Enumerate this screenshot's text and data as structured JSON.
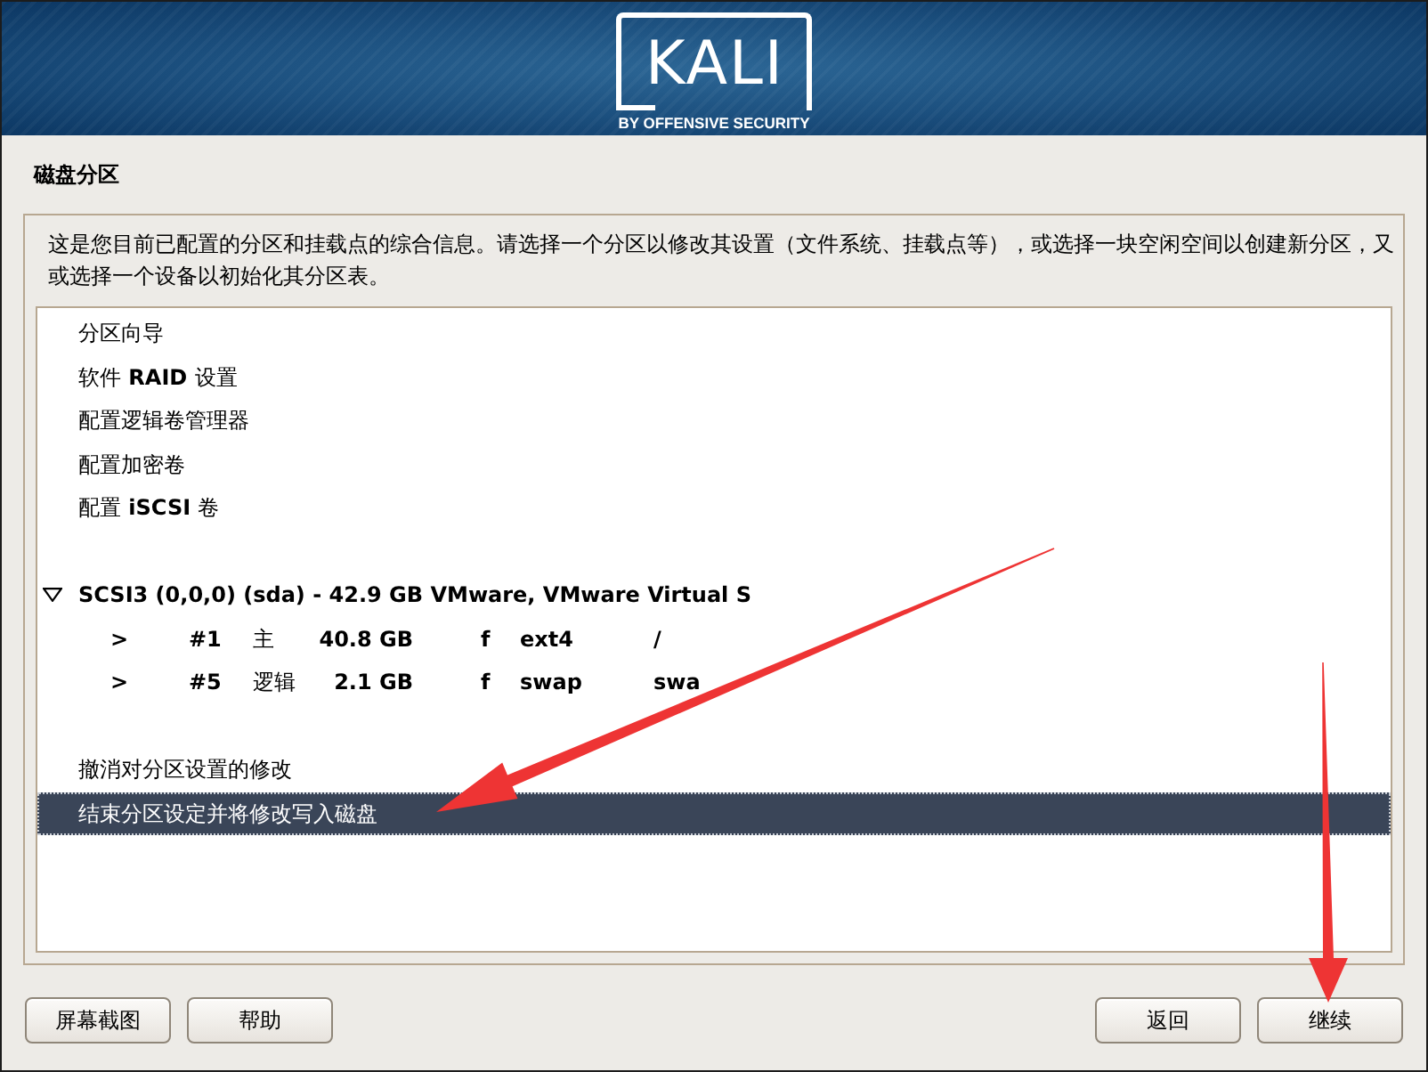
{
  "header": {
    "logo_wordmark": "KALI",
    "logo_tagline": "BY OFFENSIVE SECURITY"
  },
  "page_title": "磁盘分区",
  "description": "这是您目前已配置的分区和挂载点的综合信息。请选择一个分区以修改其设置（文件系统、挂载点等），或选择一块空闲空间以创建新分区，又或选择一个设备以初始化其分区表。",
  "partition_list": {
    "sections": [
      {
        "kind": "actions",
        "items": [
          {
            "label": "分区向导",
            "selected": false
          },
          {
            "label": "软件 RAID 设置",
            "selected": false
          },
          {
            "label": "配置逻辑卷管理器",
            "selected": false
          },
          {
            "label": "配置加密卷",
            "selected": false
          },
          {
            "label": "配置 iSCSI 卷",
            "selected": false
          }
        ]
      },
      {
        "kind": "device",
        "label": "SCSI3 (0,0,0) (sda) - 42.9 GB VMware, VMware Virtual S",
        "expanded": true,
        "selected": false,
        "partitions": [
          {
            "marker": ">",
            "number": "#1",
            "type": "主",
            "size": "40.8 GB",
            "format_flag": "f",
            "filesystem": "ext4",
            "mount_point": "/",
            "selected": false
          },
          {
            "marker": ">",
            "number": "#5",
            "type": "逻辑",
            "size": "2.1 GB",
            "format_flag": "f",
            "filesystem": "swap",
            "mount_point": "swa",
            "selected": false
          }
        ]
      },
      {
        "kind": "actions",
        "items": [
          {
            "label": "撤消对分区设置的修改",
            "selected": false
          },
          {
            "label": "结束分区设定并将修改写入磁盘",
            "selected": true
          }
        ]
      }
    ]
  },
  "footer": {
    "left_buttons": [
      {
        "label": "屏幕截图"
      },
      {
        "label": "帮助"
      }
    ],
    "right_buttons": [
      {
        "label": "返回"
      },
      {
        "label": "继续"
      }
    ]
  }
}
